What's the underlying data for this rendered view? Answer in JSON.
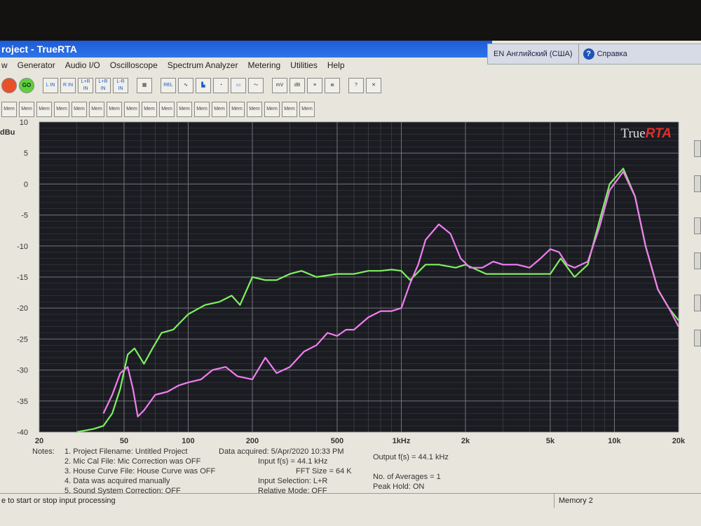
{
  "window": {
    "title": "roject - TrueRTA",
    "language": "EN Английский (США)",
    "help": "Справка"
  },
  "menu": [
    "w",
    "Generator",
    "Audio I/O",
    "Oscilloscope",
    "Spectrum Analyzer",
    "Metering",
    "Utilities",
    "Help"
  ],
  "toolbar": {
    "go": "GO",
    "buttons": [
      "L IN",
      "R IN",
      "L+R IN",
      "L+R IN",
      "L-R IN",
      "REL",
      "mV",
      "dB",
      "?"
    ]
  },
  "memory_buttons": [
    "Mem",
    "Mem",
    "Mem",
    "Mem",
    "Mem",
    "Mem",
    "Mem",
    "Mem",
    "Mem",
    "Mem",
    "Mem",
    "Mem",
    "Mem",
    "Mem",
    "Mem",
    "Mem",
    "Mem",
    "Mem"
  ],
  "notes": {
    "label": "Notes:",
    "items": [
      "1. Project Filename: Untitled Project",
      "2. Mic Cal File: Mic Correction was OFF",
      "3. House Curve File: House Curve was OFF",
      "4. Data was acquired manually",
      "5. Sound System Correction: OFF"
    ],
    "data_acquired": "Data acquired: 5/Apr/2020 10:33 PM",
    "input_fs": "Input f(s) = 44.1 kHz",
    "fft_size": "FFT Size = 64 K",
    "input_selection": "Input Selection: L+R",
    "relative_mode": "Relative Mode: OFF",
    "output_fs": "Output f(s) = 44.1 kHz",
    "averages": "No. of Averages = 1",
    "peak_hold": "Peak Hold: ON"
  },
  "status": {
    "hint": "e to start or stop input processing",
    "memory": "Memory 2"
  },
  "colors": {
    "plot_bg": "#1b1c22",
    "grid": "#7d7f86",
    "green_trace": "#7ff060",
    "pink_trace": "#f07ef0",
    "logo_red": "#e0302a"
  },
  "chart_data": {
    "type": "line",
    "logo": "TrueRTA",
    "logo_prefix": "True",
    "logo_suffix": "RTA",
    "ylabel": "dBu",
    "xscale": "log",
    "xlim": [
      20,
      20000
    ],
    "ylim": [
      -40,
      10
    ],
    "x_ticks": [
      20,
      50,
      100,
      200,
      500,
      1000,
      2000,
      5000,
      10000,
      20000
    ],
    "x_tick_labels": [
      "20",
      "50",
      "100",
      "200",
      "500",
      "1kHz",
      "2k",
      "5k",
      "10k",
      "20k"
    ],
    "y_ticks": [
      10,
      5,
      0,
      -5,
      -10,
      -15,
      -20,
      -25,
      -30,
      -35,
      -40
    ],
    "y_tick_labels": [
      "10",
      "5",
      "0",
      "-5",
      "-10",
      "-15",
      "-20",
      "-25",
      "-30",
      "-35",
      "-40"
    ],
    "grid": true,
    "series": [
      {
        "color": "green",
        "x": [
          30,
          36,
          40,
          44,
          48,
          52,
          56,
          62,
          68,
          75,
          85,
          100,
          120,
          140,
          160,
          175,
          200,
          230,
          260,
          300,
          340,
          400,
          500,
          600,
          700,
          800,
          900,
          1000,
          1100,
          1300,
          1500,
          1800,
          2000,
          2500,
          3000,
          4000,
          5000,
          5600,
          6500,
          7500,
          8500,
          9500,
          11000,
          12500,
          14000,
          16000,
          18000,
          20000
        ],
        "y": [
          -40,
          -39.5,
          -39,
          -37,
          -33,
          -27.5,
          -26.5,
          -29,
          -26.5,
          -24,
          -23.5,
          -21,
          -19.5,
          -19,
          -18,
          -19.5,
          -15,
          -15.5,
          -15.5,
          -14.5,
          -14,
          -15,
          -14.5,
          -14.5,
          -14,
          -14,
          -13.8,
          -14,
          -15.5,
          -13,
          -13,
          -13.5,
          -13,
          -14.5,
          -14.5,
          -14.5,
          -14.5,
          -12,
          -15,
          -13,
          -6,
          0,
          2.5,
          -2,
          -10,
          -17,
          -20,
          -22
        ]
      },
      {
        "color": "pink",
        "x": [
          40,
          44,
          48,
          50,
          52,
          55,
          58,
          62,
          70,
          80,
          90,
          100,
          115,
          130,
          150,
          170,
          200,
          230,
          260,
          300,
          350,
          400,
          450,
          500,
          550,
          600,
          700,
          800,
          900,
          1000,
          1100,
          1200,
          1300,
          1500,
          1700,
          1900,
          2100,
          2400,
          2700,
          3000,
          3500,
          4000,
          4500,
          5000,
          5500,
          6000,
          6500,
          7500,
          8500,
          9500,
          11000,
          12500,
          14000,
          16000,
          18000,
          20000
        ],
        "y": [
          -37,
          -34,
          -30.5,
          -30,
          -29.5,
          -33,
          -37.5,
          -36.5,
          -34,
          -33.5,
          -32.5,
          -32,
          -31.5,
          -30,
          -29.5,
          -31,
          -31.5,
          -28,
          -30.5,
          -29.5,
          -27,
          -26,
          -24,
          -24.5,
          -23.5,
          -23.5,
          -21.5,
          -20.5,
          -20.5,
          -20,
          -16,
          -13,
          -9,
          -6.5,
          -8,
          -12,
          -13.5,
          -13.5,
          -12.5,
          -13,
          -13,
          -13.5,
          -12,
          -10.5,
          -11,
          -13,
          -13.5,
          -12.5,
          -7,
          -1,
          2,
          -2,
          -10,
          -17,
          -20,
          -23
        ]
      }
    ]
  }
}
